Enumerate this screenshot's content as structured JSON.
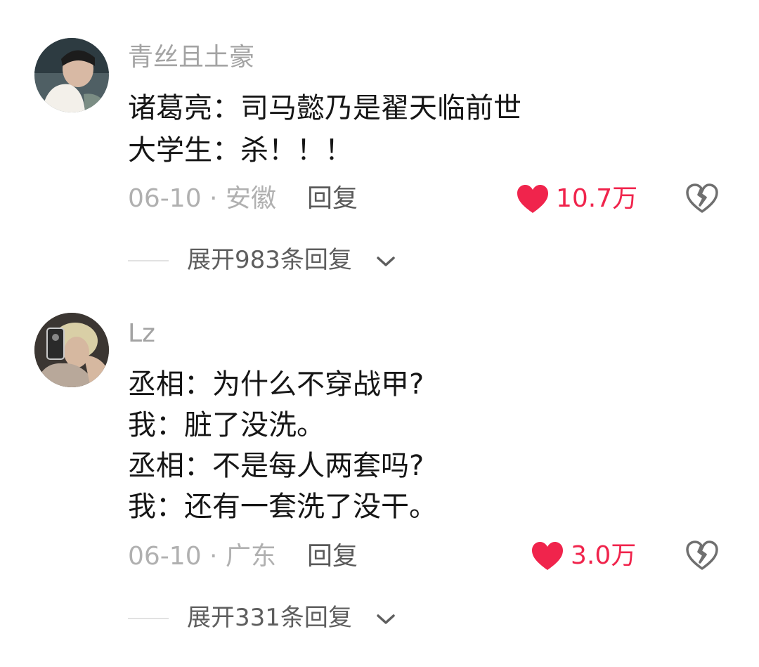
{
  "comments": [
    {
      "username": "青丝且土豪",
      "lines": [
        "诸葛亮：司马懿乃是翟天临前世",
        "大学生：杀！！！"
      ],
      "date_location": "06-10 · 安徽",
      "reply_label": "回复",
      "likes": "10.7万",
      "expand_label": "展开983条回复"
    },
    {
      "username": "Lz",
      "lines": [
        "丞相：为什么不穿战甲?",
        "我：脏了没洗。",
        "丞相：不是每人两套吗?",
        "我：还有一套洗了没干。"
      ],
      "date_location": "06-10 · 广东",
      "reply_label": "回复",
      "likes": "3.0万",
      "expand_label": "展开331条回复"
    }
  ],
  "colors": {
    "like_red": "#f0244c",
    "username_gray": "#a3a3a3",
    "text_dark": "#161616"
  },
  "icons": [
    "avatar",
    "heart-icon",
    "broken-heart-icon",
    "chevron-down-icon"
  ]
}
